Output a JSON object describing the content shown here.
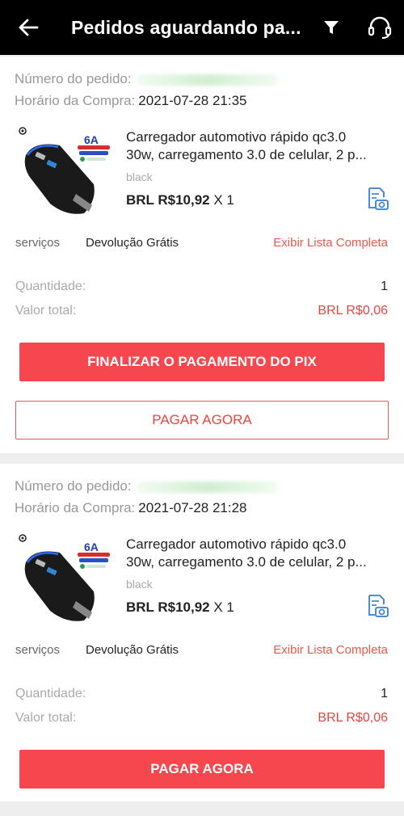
{
  "header": {
    "title": "Pedidos aguardando pa...",
    "back_icon": "arrow-left-icon",
    "filter_icon": "filter-icon",
    "support_icon": "headset-icon"
  },
  "orders": [
    {
      "order_number_label": "Número do pedido:",
      "purchase_time_label": "Horário da Compra:",
      "purchase_time": "2021-07-28 21:35",
      "product": {
        "name_line1": "Carregador automotivo rápido qc3.0",
        "name_line2": "30w, carregamento 3.0 de celular, 2 p...",
        "variant": "black",
        "price": "BRL R$10,92",
        "qty": "X 1",
        "badge": "6A"
      },
      "services_label": "serviços",
      "services_value": "Devolução Grátis",
      "full_list_link": "Exibir Lista Completa",
      "quantity_label": "Quantidade:",
      "quantity_value": "1",
      "total_label": "Valor total:",
      "total_value": "BRL R$0,06",
      "primary_button": "FINALIZAR O PAGAMENTO DO PIX",
      "secondary_button": "PAGAR AGORA"
    },
    {
      "order_number_label": "Número do pedido:",
      "purchase_time_label": "Horário da Compra:",
      "purchase_time": "2021-07-28 21:28",
      "product": {
        "name_line1": "Carregador automotivo rápido qc3.0",
        "name_line2": "30w, carregamento 3.0 de celular, 2 p...",
        "variant": "black",
        "price": "BRL R$10,92",
        "qty": "X 1",
        "badge": "6A"
      },
      "services_label": "serviços",
      "services_value": "Devolução Grátis",
      "full_list_link": "Exibir Lista Completa",
      "quantity_label": "Quantidade:",
      "quantity_value": "1",
      "total_label": "Valor total:",
      "total_value": "BRL R$0,06",
      "primary_button": "PAGAR AGORA"
    }
  ],
  "colors": {
    "accent": "#f5474d",
    "link": "#e55a4a",
    "header_bg": "#000000",
    "snapshot_icon": "#3a7bd5"
  }
}
